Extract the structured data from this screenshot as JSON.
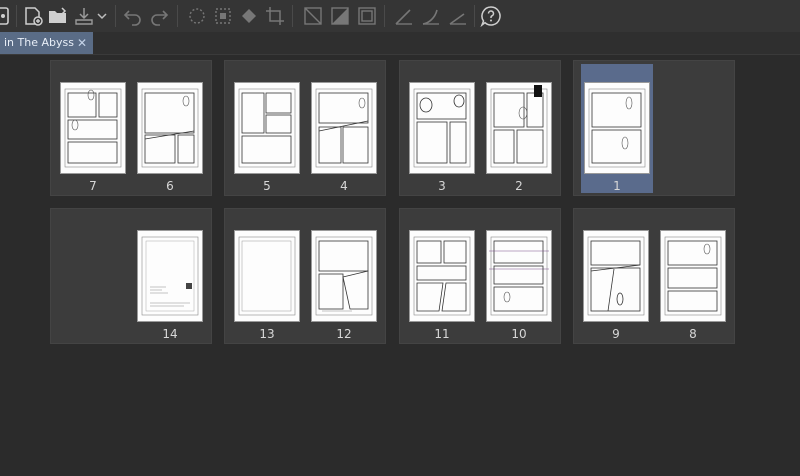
{
  "toolbar": {
    "items": [
      {
        "name": "app-menu-icon"
      },
      {
        "name": "add-page-icon"
      },
      {
        "name": "open-folder-icon"
      },
      {
        "name": "export-icon"
      },
      {
        "name": "dropdown-arrow-icon"
      },
      {
        "name": "undo-icon"
      },
      {
        "name": "redo-icon"
      },
      {
        "name": "clear-selection-icon"
      },
      {
        "name": "transform-selection-icon"
      },
      {
        "name": "fill-icon"
      },
      {
        "name": "crop-icon"
      },
      {
        "name": "hide-outside-selection-icon"
      },
      {
        "name": "convert-layer-icon"
      },
      {
        "name": "frame-border-icon"
      },
      {
        "name": "ruler-line-icon"
      },
      {
        "name": "curve-ruler-icon"
      },
      {
        "name": "perspective-ruler-icon"
      },
      {
        "name": "help-icon"
      }
    ]
  },
  "tab": {
    "label": "in The Abyss",
    "close": "✕"
  },
  "spreads": [
    {
      "pages": [
        "7",
        "6"
      ],
      "selected": false
    },
    {
      "pages": [
        "5",
        "4"
      ],
      "selected": false
    },
    {
      "pages": [
        "3",
        "2"
      ],
      "selected": false
    },
    {
      "pages": [
        "1"
      ],
      "selected": true
    },
    {
      "pages": [
        "14"
      ],
      "selected": false
    },
    {
      "pages": [
        "13",
        "12"
      ],
      "selected": false
    },
    {
      "pages": [
        "11",
        "10"
      ],
      "selected": false
    },
    {
      "pages": [
        "9",
        "8"
      ],
      "selected": false
    }
  ],
  "colors": {
    "background": "#2b2b2b",
    "spread": "#3c3c3c",
    "selection": "#5a6b8c",
    "tab_active": "#5a6c86"
  }
}
